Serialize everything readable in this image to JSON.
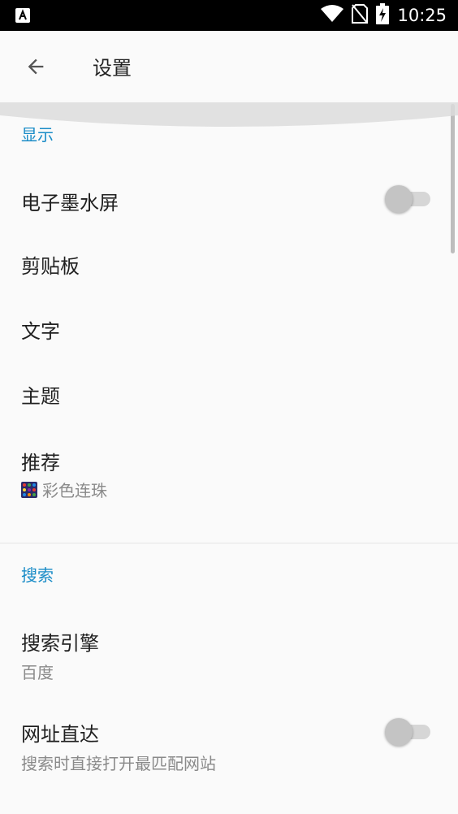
{
  "status_bar": {
    "time": "10:25",
    "icons": [
      "accessibility-a-icon",
      "wifi-icon",
      "no-sim-icon",
      "battery-charging-icon"
    ]
  },
  "app_bar": {
    "title": "设置",
    "back_icon": "arrow-back-icon"
  },
  "sections": {
    "display": {
      "header": "显示",
      "items": [
        {
          "title": "电子墨水屏",
          "toggle": false
        },
        {
          "title": "剪贴板"
        },
        {
          "title": "文字"
        },
        {
          "title": "主题"
        },
        {
          "title": "推荐",
          "subtitle": "彩色连珠",
          "subtitle_icon": "color-beads-app-icon"
        }
      ]
    },
    "search": {
      "header": "搜索",
      "items": [
        {
          "title": "搜索引擎",
          "subtitle": "百度"
        },
        {
          "title": "网址直达",
          "subtitle": "搜索时直接打开最匹配网站",
          "toggle": false
        }
      ]
    }
  },
  "colors": {
    "accent": "#1a8cc7",
    "background": "#fafafa",
    "status_bar": "#000000",
    "toggle_off_track": "#d6d6d6",
    "toggle_off_knob": "#c4c4c4"
  }
}
